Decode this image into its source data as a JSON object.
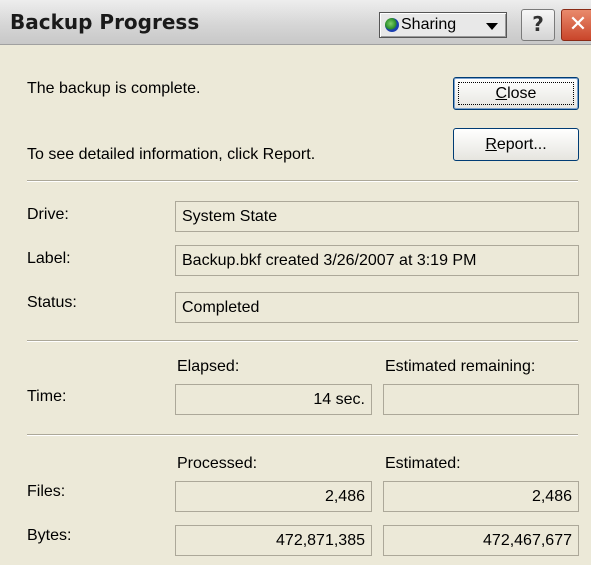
{
  "window": {
    "title": "Backup Progress",
    "sharing_label": "Sharing",
    "help_label": "?",
    "close_glyph": "✕"
  },
  "status_message": "The backup is complete.",
  "report_hint": "To see detailed information, click Report.",
  "buttons": {
    "close": {
      "mnemonic": "C",
      "rest": "lose"
    },
    "report": {
      "mnemonic": "R",
      "rest": "eport..."
    }
  },
  "info": {
    "drive_label": "Drive:",
    "drive_value": "System State",
    "label_label": "Label:",
    "label_value": "Backup.bkf created 3/26/2007 at 3:19 PM",
    "status_label": "Status:",
    "status_value": "Completed"
  },
  "time": {
    "row_label": "Time:",
    "elapsed_header": "Elapsed:",
    "remaining_header": "Estimated remaining:",
    "elapsed_value": "14 sec.",
    "remaining_value": ""
  },
  "counts": {
    "processed_header": "Processed:",
    "estimated_header": "Estimated:",
    "files_label": "Files:",
    "files_processed": "2,486",
    "files_estimated": "2,486",
    "bytes_label": "Bytes:",
    "bytes_processed": "472,871,385",
    "bytes_estimated": "472,467,677"
  },
  "colors": {
    "dialog_bg": "#ece9d8",
    "close_button": "#c9452a"
  }
}
